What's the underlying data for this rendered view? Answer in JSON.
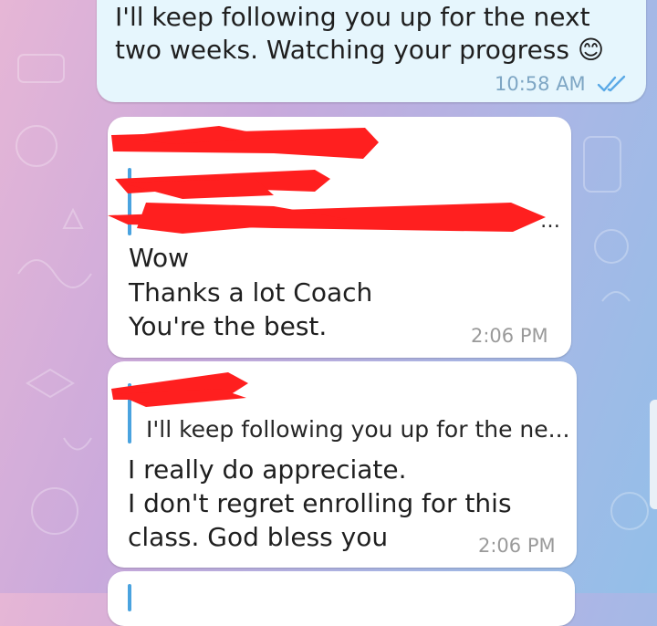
{
  "colors": {
    "outgoing_bubble": "#e6f6fd",
    "incoming_bubble": "#ffffff",
    "reply_accent": "#4aa3df",
    "read_ticks": "#5aa9e6",
    "redaction": "#ff1f1f"
  },
  "messages": [
    {
      "direction": "outgoing",
      "lines": [
        "I'll keep following you up for the next",
        "two weeks. Watching your progress 😊"
      ],
      "time": "10:58 AM",
      "status_icon": "double-check-icon"
    },
    {
      "direction": "incoming",
      "lines": [
        "Wow",
        "Thanks a lot Coach",
        "You're the best."
      ],
      "time": "2:06 PM",
      "reply_preview": "…"
    },
    {
      "direction": "incoming",
      "lines": [
        "I really do appreciate.",
        "I don't regret enrolling for this",
        "class. God bless you"
      ],
      "time": "2:06 PM",
      "reply_preview": "I'll keep following you up for the ne..."
    }
  ]
}
